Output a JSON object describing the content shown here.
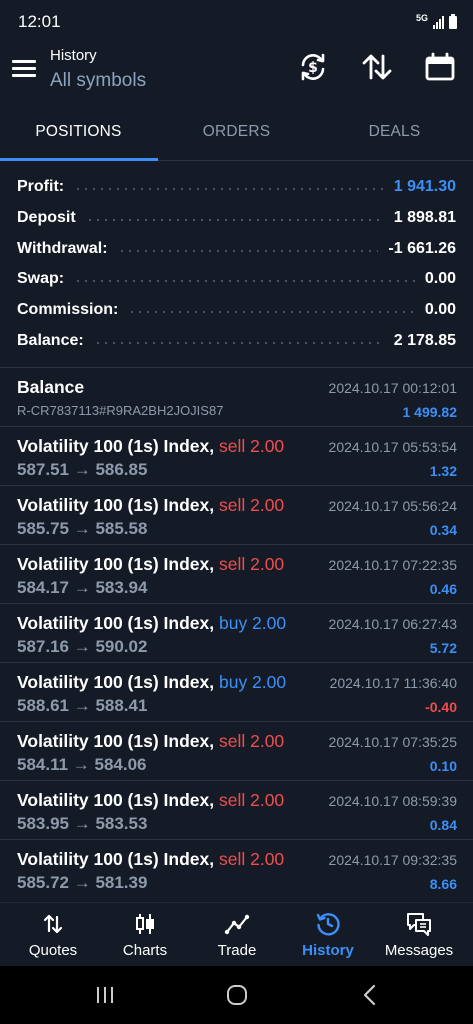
{
  "status_bar": {
    "time": "12:01",
    "network": "5G"
  },
  "header": {
    "title": "History",
    "subtitle": "All symbols"
  },
  "tabs": [
    {
      "label": "POSITIONS",
      "active": true
    },
    {
      "label": "ORDERS",
      "active": false
    },
    {
      "label": "DEALS",
      "active": false
    }
  ],
  "summary": [
    {
      "label": "Profit:",
      "value": "1 941.30",
      "highlight": true
    },
    {
      "label": "Deposit",
      "value": "1 898.81"
    },
    {
      "label": "Withdrawal:",
      "value": "-1 661.26"
    },
    {
      "label": "Swap:",
      "value": "0.00"
    },
    {
      "label": "Commission:",
      "value": "0.00"
    },
    {
      "label": "Balance:",
      "value": "2 178.85"
    }
  ],
  "balance_entry": {
    "title": "Balance",
    "comment": "R-CR7837113#R9RA2BH2JOJIS87",
    "time": "2024.10.17 00:12:01",
    "amount": "1 499.82"
  },
  "deals": [
    {
      "symbol": "Volatility 100 (1s) Index,",
      "side": "sell 2.00",
      "prices": "587.51 → 586.85",
      "time": "2024.10.17 05:53:54",
      "profit": "1.32"
    },
    {
      "symbol": "Volatility 100 (1s) Index,",
      "side": "sell 2.00",
      "prices": "585.75 → 585.58",
      "time": "2024.10.17 05:56:24",
      "profit": "0.34"
    },
    {
      "symbol": "Volatility 100 (1s) Index,",
      "side": "sell 2.00",
      "prices": "584.17 → 583.94",
      "time": "2024.10.17 07:22:35",
      "profit": "0.46"
    },
    {
      "symbol": "Volatility 100 (1s) Index,",
      "side": "buy 2.00",
      "prices": "587.16 → 590.02",
      "time": "2024.10.17 06:27:43",
      "profit": "5.72"
    },
    {
      "symbol": "Volatility 100 (1s) Index,",
      "side": "buy 2.00",
      "prices": "588.61 → 588.41",
      "time": "2024.10.17 11:36:40",
      "profit": "-0.40"
    },
    {
      "symbol": "Volatility 100 (1s) Index,",
      "side": "sell 2.00",
      "prices": "584.11 → 584.06",
      "time": "2024.10.17 07:35:25",
      "profit": "0.10"
    },
    {
      "symbol": "Volatility 100 (1s) Index,",
      "side": "sell 2.00",
      "prices": "583.95 → 583.53",
      "time": "2024.10.17 08:59:39",
      "profit": "0.84"
    },
    {
      "symbol": "Volatility 100 (1s) Index,",
      "side": "sell 2.00",
      "prices": "585.72 → 581.39",
      "time": "2024.10.17 09:32:35",
      "profit": "8.66"
    }
  ],
  "bottom_nav": [
    {
      "label": "Quotes",
      "icon": "quotes-icon",
      "active": false
    },
    {
      "label": "Charts",
      "icon": "charts-icon",
      "active": false
    },
    {
      "label": "Trade",
      "icon": "trade-icon",
      "active": false
    },
    {
      "label": "History",
      "icon": "history-icon",
      "active": true
    },
    {
      "label": "Messages",
      "icon": "messages-icon",
      "active": false
    }
  ],
  "colors": {
    "accent": "#3b8ff7",
    "sell": "#f04e4e",
    "background": "#141b26",
    "muted": "#8e9aab"
  }
}
